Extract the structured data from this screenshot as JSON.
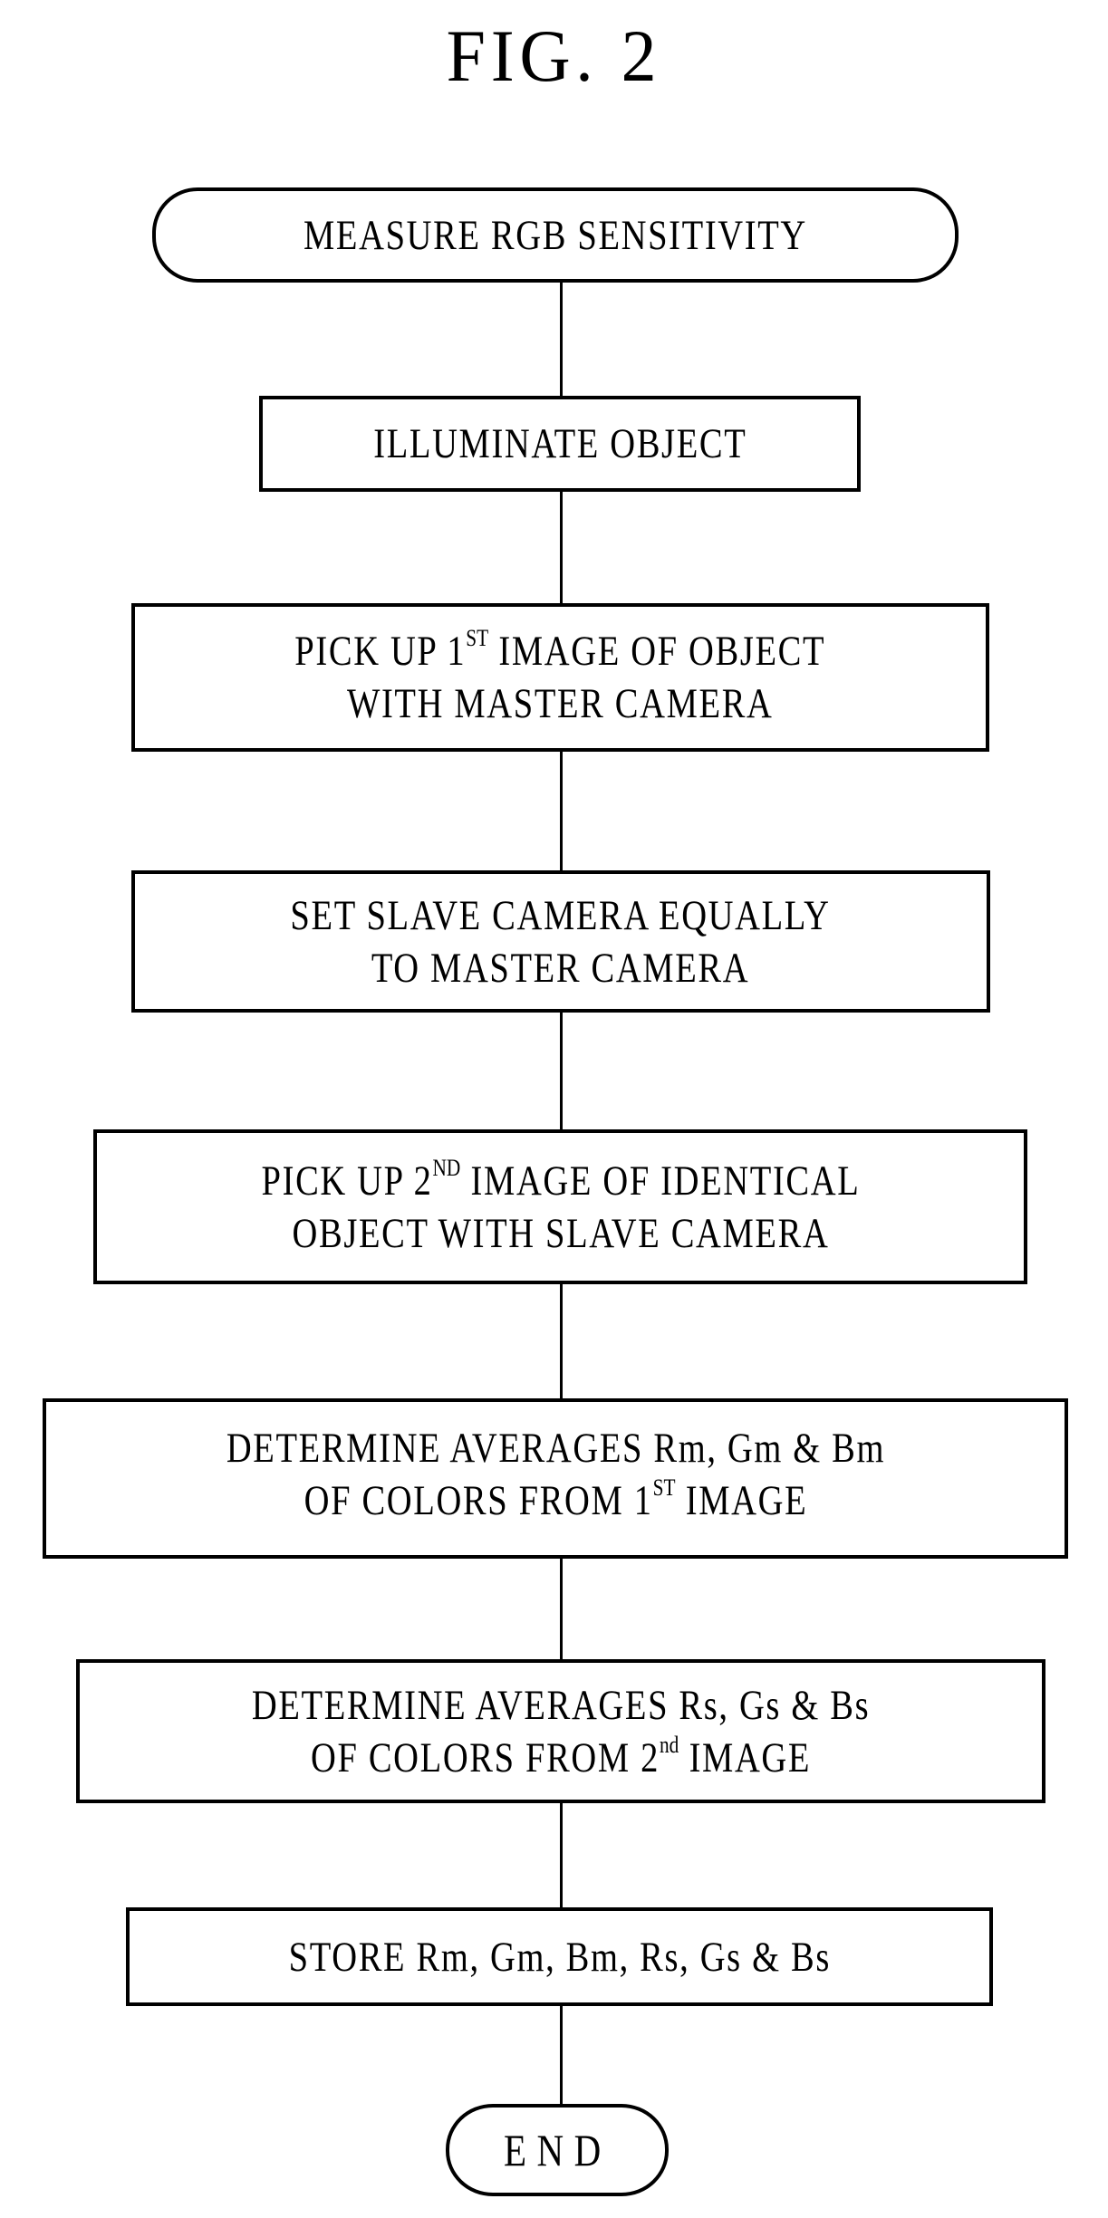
{
  "figure": {
    "title": "FIG. 2"
  },
  "flowchart": {
    "start": {
      "label": "MEASURE RGB SENSITIVITY"
    },
    "steps": [
      {
        "line1": "ILLUMINATE OBJECT"
      },
      {
        "line1_pre": "PICK UP 1",
        "line1_sup": "ST",
        "line1_post": " IMAGE OF OBJECT",
        "line2": "WITH MASTER CAMERA"
      },
      {
        "line1": "SET SLAVE CAMERA EQUALLY",
        "line2": "TO MASTER CAMERA"
      },
      {
        "line1_pre": "PICK UP 2",
        "line1_sup": "ND",
        "line1_post": " IMAGE OF IDENTICAL",
        "line2": "OBJECT WITH SLAVE CAMERA"
      },
      {
        "line1": "DETERMINE AVERAGES Rm, Gm & Bm",
        "line2_pre": "OF COLORS FROM 1",
        "line2_sup": "ST",
        "line2_post": " IMAGE"
      },
      {
        "line1": "DETERMINE AVERAGES Rs, Gs & Bs",
        "line2_pre": "OF COLORS FROM 2",
        "line2_sup": "nd",
        "line2_post": " IMAGE"
      },
      {
        "line1": "STORE Rm, Gm, Bm, Rs, Gs & Bs"
      }
    ],
    "end": {
      "label": "END"
    }
  }
}
